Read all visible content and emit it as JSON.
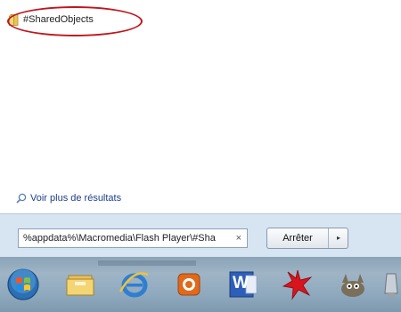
{
  "results": {
    "item_label": "#SharedObjects",
    "see_more_label": "Voir plus de résultats"
  },
  "search": {
    "value": "%appdata%\\Macromedia\\Flash Player\\#Sha",
    "clear_symbol": "×"
  },
  "shutdown": {
    "label": "Arrêter",
    "arrow": "▸"
  },
  "taskbar": {
    "items": [
      {
        "icon": "windows-start-orb-icon"
      },
      {
        "icon": "file-explorer-icon"
      },
      {
        "icon": "internet-explorer-icon"
      },
      {
        "icon": "media-player-icon"
      },
      {
        "icon": "word-icon"
      },
      {
        "icon": "red-star-app-icon"
      },
      {
        "icon": "gimp-icon"
      },
      {
        "icon": "partial-app-icon"
      }
    ],
    "word_letter": "W"
  },
  "colors": {
    "highlight_oval": "#c0151e",
    "link": "#1e3f8a",
    "taskbar": "#8ea8bd"
  }
}
